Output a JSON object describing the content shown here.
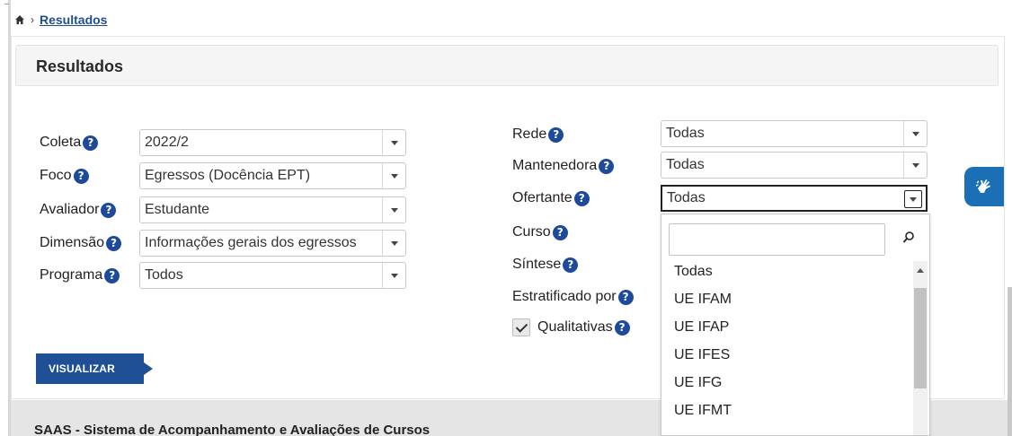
{
  "breadcrumb": {
    "home_icon": "home-icon",
    "current": "Resultados"
  },
  "panel": {
    "title": "Resultados"
  },
  "left_form": [
    {
      "label": "Coleta",
      "value": "2022/2"
    },
    {
      "label": "Foco",
      "value": "Egressos (Docência EPT)"
    },
    {
      "label": "Avaliador",
      "value": "Estudante"
    },
    {
      "label": "Dimensão",
      "value": "Informações gerais dos egressos"
    },
    {
      "label": "Programa",
      "value": "Todos"
    }
  ],
  "right_form": {
    "rede": {
      "label": "Rede",
      "value": "Todas"
    },
    "mantenedora": {
      "label": "Mantenedora",
      "value": "Todas"
    },
    "ofertante": {
      "label": "Ofertante",
      "value": "Todas"
    },
    "curso": {
      "label": "Curso"
    },
    "sintese": {
      "label": "Síntese"
    },
    "estratificado": {
      "label": "Estratificado por"
    },
    "qualitativas": {
      "label": "Qualitativas",
      "checked": true
    }
  },
  "help_glyph": "?",
  "visualizar_label": "VISUALIZAR",
  "dropdown": {
    "search_value": "",
    "options": [
      "Todas",
      "UE IFAM",
      "UE IFAP",
      "UE IFES",
      "UE IFG",
      "UE IFMT"
    ]
  },
  "footer": {
    "text": "SAAS - Sistema de Acompanhamento e Avaliações de Cursos"
  },
  "colors": {
    "accent": "#1f4f94",
    "help": "#1e4a9c",
    "accessibility": "#1a6fb5"
  }
}
